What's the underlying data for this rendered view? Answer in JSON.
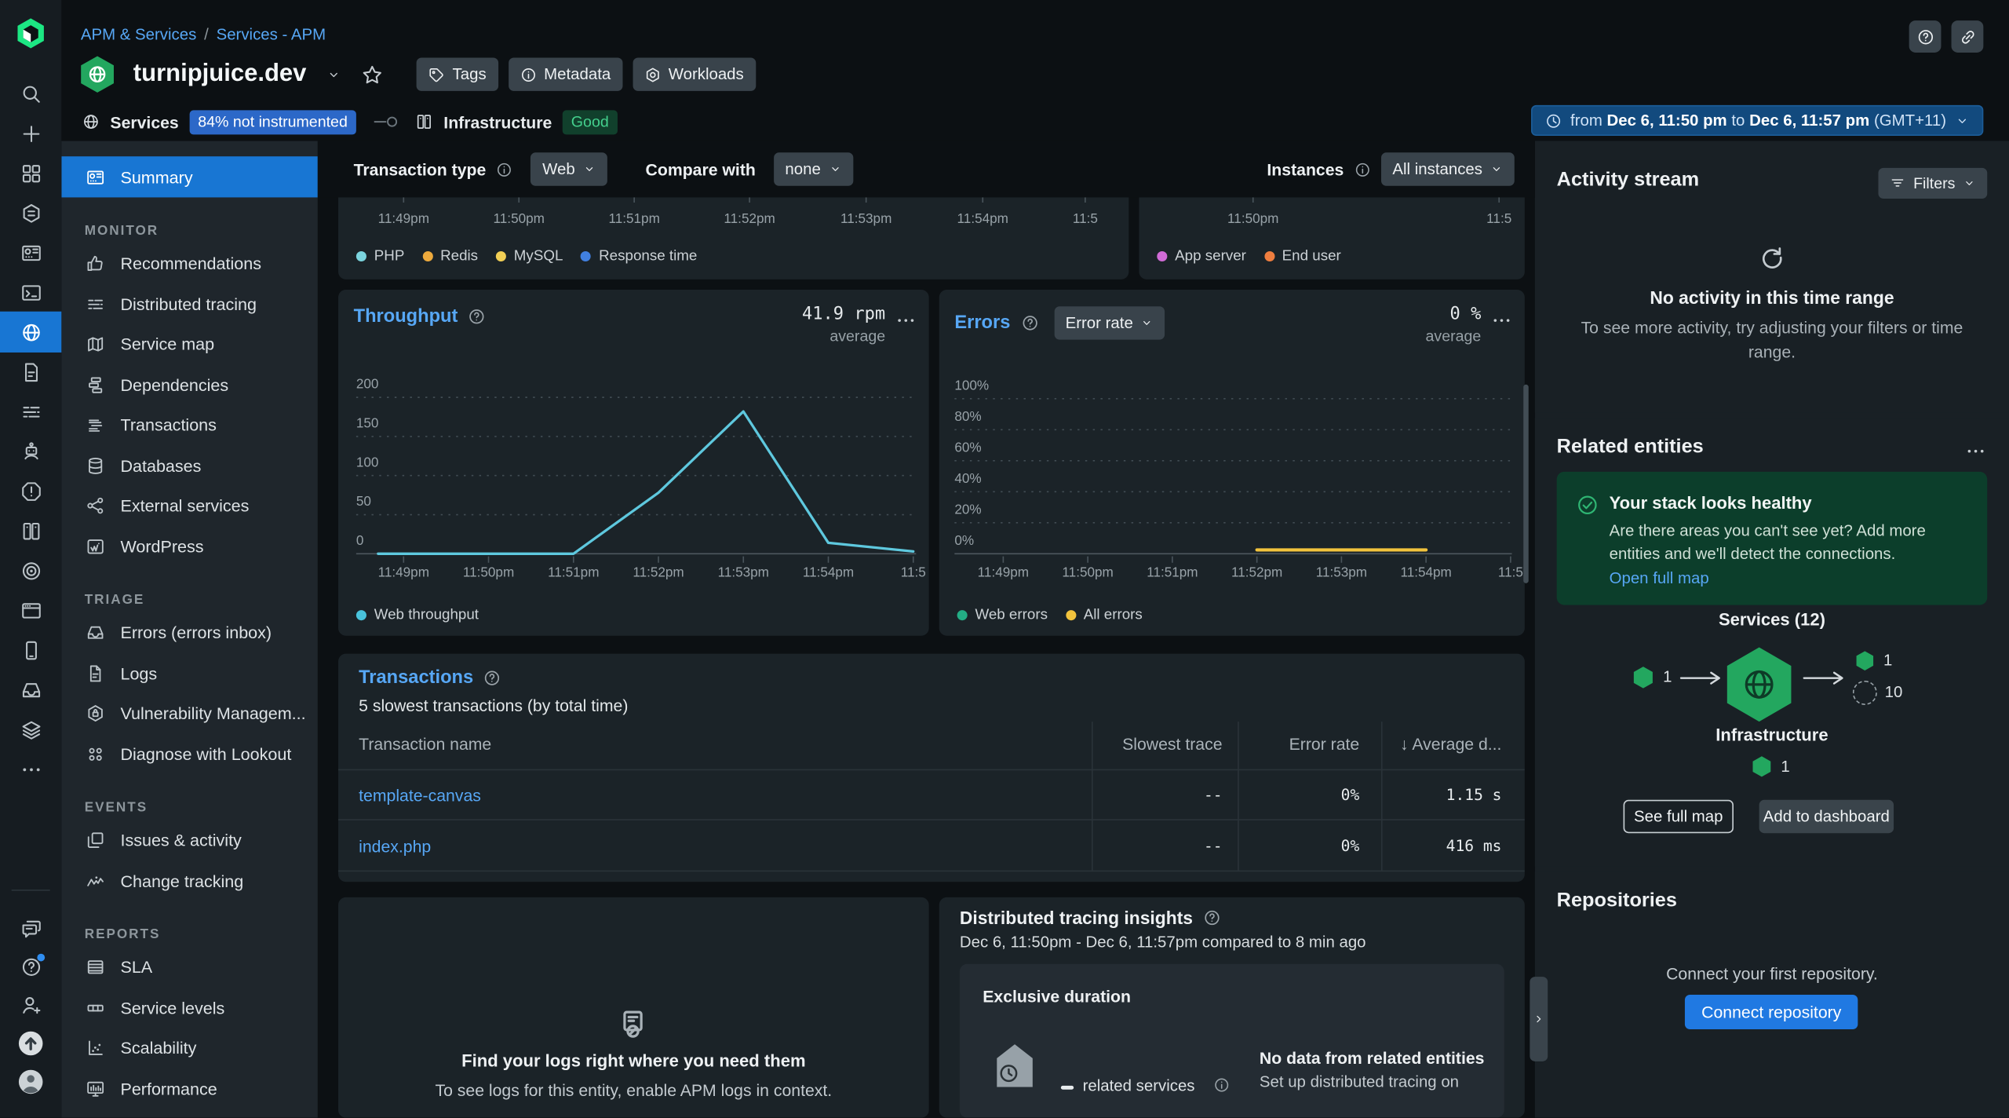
{
  "colors": {
    "accent_blue": "#1876d3",
    "link_blue": "#57a7f5",
    "entity_green": "#23a75f",
    "badge_blue": "#2c68c8",
    "good_green": "#44d08d",
    "primary_button_blue": "#2079e2",
    "warning_yellow": "#f2c33d",
    "throughput_cyan": "#5ec8de"
  },
  "header": {
    "breadcrumb": {
      "first": "APM & Services",
      "separator": "/",
      "second": "Services - APM"
    },
    "entity_name": "turnipjuice.dev",
    "tags_button": "Tags",
    "metadata_button": "Metadata",
    "workloads_button": "Workloads",
    "services_label": "Services",
    "services_badge": "84% not instrumented",
    "infrastructure_label": "Infrastructure",
    "infrastructure_status": "Good",
    "time_picker": {
      "from_word": "from",
      "start": "Dec 6, 11:50 pm",
      "to_word": "to",
      "end": "Dec 6, 11:57 pm",
      "timezone": "(GMT+11)"
    }
  },
  "rail": {
    "items": [
      {
        "icon": "new-relic-logo"
      },
      {
        "icon": "search"
      },
      {
        "icon": "add"
      },
      {
        "icon": "apps-grid"
      },
      {
        "icon": "entity-explorer"
      },
      {
        "icon": "dashboards"
      },
      {
        "icon": "query-console"
      },
      {
        "icon": "apm-globe",
        "active": true
      },
      {
        "icon": "document"
      },
      {
        "icon": "distributed-tracing"
      },
      {
        "icon": "ai-assistant"
      },
      {
        "icon": "alerts"
      },
      {
        "icon": "infrastructure-hosts"
      },
      {
        "icon": "synthetics-target"
      },
      {
        "icon": "browser-app"
      },
      {
        "icon": "mobile-app"
      },
      {
        "icon": "errors-inbox"
      },
      {
        "icon": "stacks"
      },
      {
        "icon": "more-options"
      },
      {
        "icon": "feedback-chat",
        "section": "bottom"
      },
      {
        "icon": "help",
        "dot": true,
        "section": "bottom"
      },
      {
        "icon": "invite-user",
        "section": "bottom"
      },
      {
        "icon": "upgrade-arrow",
        "section": "bottom"
      },
      {
        "icon": "user-avatar",
        "section": "bottom"
      }
    ]
  },
  "sidebar": {
    "summary": {
      "label": "Summary",
      "icon": "summary-dashboard",
      "active": true
    },
    "sections": [
      {
        "title": "MONITOR",
        "items": [
          {
            "label": "Recommendations",
            "icon": "thumbs-up"
          },
          {
            "label": "Distributed tracing",
            "icon": "distributed-tracing"
          },
          {
            "label": "Service map",
            "icon": "service-map"
          },
          {
            "label": "Dependencies",
            "icon": "dependencies"
          },
          {
            "label": "Transactions",
            "icon": "transactions"
          },
          {
            "label": "Databases",
            "icon": "database"
          },
          {
            "label": "External services",
            "icon": "external-services"
          },
          {
            "label": "WordPress",
            "icon": "wordpress"
          }
        ]
      },
      {
        "title": "TRIAGE",
        "items": [
          {
            "label": "Errors (errors inbox)",
            "icon": "errors-inbox"
          },
          {
            "label": "Logs",
            "icon": "logs-file"
          },
          {
            "label": "Vulnerability Managem...",
            "icon": "vulnerability-shield"
          },
          {
            "label": "Diagnose with Lookout",
            "icon": "lookout-dots"
          }
        ]
      },
      {
        "title": "EVENTS",
        "items": [
          {
            "label": "Issues & activity",
            "icon": "issues-copies"
          },
          {
            "label": "Change tracking",
            "icon": "change-pulse"
          }
        ]
      },
      {
        "title": "REPORTS",
        "items": [
          {
            "label": "SLA",
            "icon": "sla-report"
          },
          {
            "label": "Service levels",
            "icon": "service-levels"
          },
          {
            "label": "Scalability",
            "icon": "scalability-scatter"
          },
          {
            "label": "Performance",
            "icon": "performance-monitor"
          }
        ]
      }
    ]
  },
  "controls": {
    "transaction_type_label": "Transaction type",
    "transaction_type_value": "Web",
    "compare_with_label": "Compare with",
    "compare_with_value": "none",
    "instances_label": "Instances",
    "instances_value": "All instances"
  },
  "chart_data": [
    {
      "id": "web-transactions-time",
      "type": "line",
      "note": "partially visible, scrolled under controls",
      "xticks": [
        "11:49pm",
        "11:50pm",
        "11:51pm",
        "11:52pm",
        "11:53pm",
        "11:54pm",
        "11:5"
      ],
      "legend": [
        {
          "label": "PHP",
          "color": "#7bd4de"
        },
        {
          "label": "Redis",
          "color": "#edaa3d"
        },
        {
          "label": "MySQL",
          "color": "#f2cf55"
        },
        {
          "label": "Response time",
          "color": "#4180e0"
        }
      ]
    },
    {
      "id": "app-server-vs-end-user",
      "type": "line",
      "note": "partially visible, scrolled under controls",
      "xticks": [
        "11:50pm",
        "11:5"
      ],
      "legend": [
        {
          "label": "App server",
          "color": "#d06bd6"
        },
        {
          "label": "End user",
          "color": "#ef7e3f"
        }
      ]
    },
    {
      "id": "throughput",
      "type": "line",
      "title": "Throughput",
      "stat": "41.9 rpm",
      "stat_sub": "average",
      "ylim": [
        0,
        200
      ],
      "grid": true,
      "legend_position": "bottom",
      "yticks": [
        {
          "v": 200,
          "label": "200"
        },
        {
          "v": 150,
          "label": "150"
        },
        {
          "v": 100,
          "label": "100"
        },
        {
          "v": 50,
          "label": "50"
        },
        {
          "v": 0,
          "label": "0"
        }
      ],
      "xticks": [
        "11:49pm",
        "11:50pm",
        "11:51pm",
        "11:52pm",
        "11:53pm",
        "11:54pm",
        "11:5"
      ],
      "series": [
        {
          "name": "Web throughput",
          "color": "#5ec8de",
          "points": [
            [
              -0.3,
              0
            ],
            [
              2,
              0
            ],
            [
              3,
              78
            ],
            [
              4,
              182
            ],
            [
              5,
              14
            ],
            [
              6,
              3
            ]
          ]
        }
      ],
      "legend": [
        {
          "label": "Web throughput",
          "color": "#49c3dc"
        }
      ]
    },
    {
      "id": "errors",
      "type": "line",
      "title": "Errors",
      "dropdown": "Error rate",
      "stat": "0 %",
      "stat_sub": "average",
      "ylim": [
        0,
        100
      ],
      "grid": true,
      "legend_position": "bottom",
      "yticks": [
        {
          "v": 100,
          "label": "100%"
        },
        {
          "v": 80,
          "label": "80%"
        },
        {
          "v": 60,
          "label": "60%"
        },
        {
          "v": 40,
          "label": "40%"
        },
        {
          "v": 20,
          "label": "20%"
        },
        {
          "v": 0,
          "label": "0%"
        }
      ],
      "xticks": [
        "11:49pm",
        "11:50pm",
        "11:51pm",
        "11:52pm",
        "11:53pm",
        "11:54pm",
        "11:5"
      ],
      "series": [
        {
          "name": "All errors",
          "color": "#f2c33d",
          "points": [
            [
              3,
              0
            ],
            [
              5,
              0
            ]
          ]
        }
      ],
      "legend": [
        {
          "label": "Web errors",
          "color": "#23ad85"
        },
        {
          "label": "All errors",
          "color": "#f2c33d"
        }
      ]
    }
  ],
  "transactions": {
    "title": "Transactions",
    "subtitle": "5 slowest transactions (by total time)",
    "columns": [
      "Transaction name",
      "Slowest trace",
      "Error rate",
      "↓ Average d..."
    ],
    "rows": [
      {
        "name": "template-canvas",
        "slowest_trace": "--",
        "error_rate": "0%",
        "average_duration": "1.15 s"
      },
      {
        "name": "index.php",
        "slowest_trace": "--",
        "error_rate": "0%",
        "average_duration": "416 ms"
      }
    ]
  },
  "logs_panel": {
    "title": "Find your logs right where you need them",
    "subtitle": "To see logs for this entity, enable APM logs in context."
  },
  "tracing_insights": {
    "title": "Distributed tracing insights",
    "date_range": "Dec 6, 11:50pm - Dec 6, 11:57pm compared to 8 min ago",
    "panel_title": "Exclusive duration",
    "legend_label": "related services",
    "empty_title": "No data from related entities",
    "empty_line": "Set up distributed tracing on"
  },
  "activity_stream": {
    "title": "Activity stream",
    "filters_label": "Filters",
    "empty_title": "No activity in this time range",
    "empty_body": "To see more activity, try adjusting your filters or time range."
  },
  "related_entities": {
    "title": "Related entities",
    "banner_title": "Your stack looks healthy",
    "banner_body": "Are there areas you can't see yet? Add more entities and we'll detect the connections.",
    "banner_link": "Open full map",
    "services_label": "Services (12)",
    "infrastructure_label": "Infrastructure",
    "counts": {
      "upstream": "1",
      "downstream_healthy": "1",
      "downstream_unknown": "10",
      "infrastructure": "1"
    },
    "see_full_map": "See full map",
    "add_to_dashboard": "Add to dashboard"
  },
  "repositories": {
    "title": "Repositories",
    "empty_body": "Connect your first repository.",
    "connect_button": "Connect repository"
  }
}
